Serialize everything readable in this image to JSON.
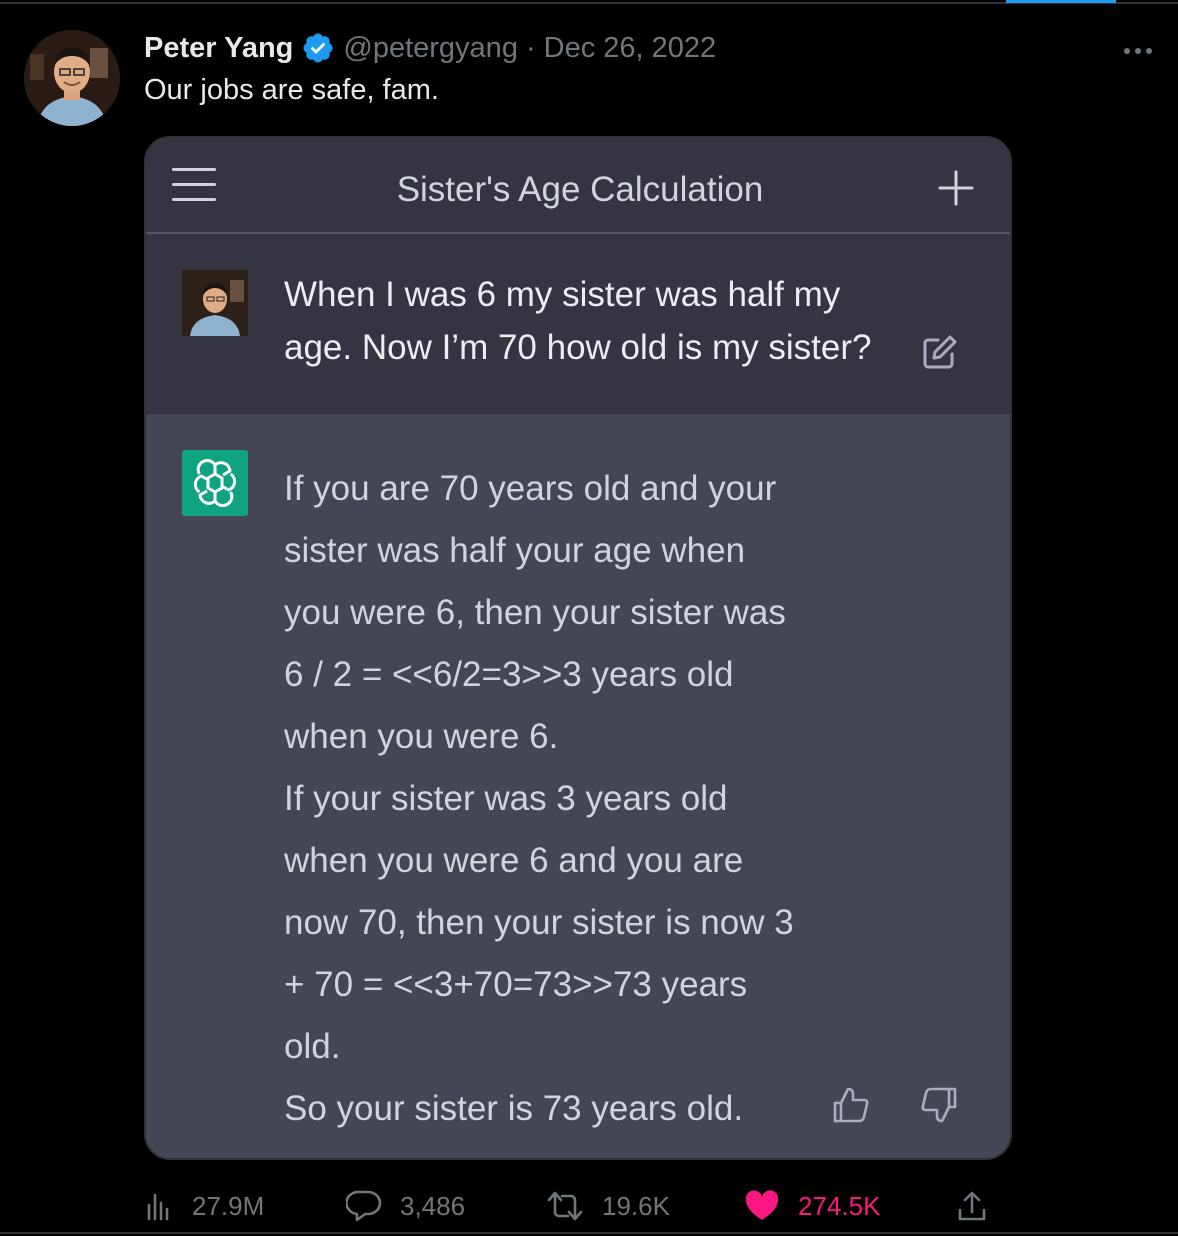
{
  "tweet": {
    "author_name": "Peter Yang",
    "handle": "@petergyang",
    "separator": "·",
    "date": "Dec 26, 2022",
    "text": "Our jobs are safe, fam.",
    "more_icon": "more-horizontal-icon",
    "verified_icon": "verified-badge-icon"
  },
  "chat": {
    "title": "Sister's Age Calculation",
    "menu_icon": "hamburger-menu-icon",
    "new_chat_icon": "plus-icon",
    "user_message_lines": [
      "When I was 6 my sister was half my",
      "age. Now I’m 70 how old is my sister?"
    ],
    "edit_icon": "edit-icon",
    "assistant_lines": [
      "If you are 70 years old and your",
      "sister was half your age when",
      "you were 6, then your sister was",
      "6 / 2 = <<6/2=3>>3 years old",
      "when you were 6.",
      "If your sister was 3 years old",
      "when you were 6 and you are",
      "now 70, then your sister is now 3",
      "+ 70 = <<3+70=73>>73 years",
      "old.",
      "So your sister is 73 years old."
    ],
    "feedback_icons": [
      "thumbs-up-icon",
      "thumbs-down-icon"
    ]
  },
  "metrics": {
    "views": "27.9M",
    "replies": "3,486",
    "retweets": "19.6K",
    "likes": "274.5K"
  },
  "colors": {
    "background": "#000000",
    "verified": "#1d9bf0",
    "like": "#f91880",
    "muted": "#71767b",
    "chat_user_bg": "#343541",
    "chat_ai_bg": "#444654",
    "gpt_green": "#10a37f"
  }
}
